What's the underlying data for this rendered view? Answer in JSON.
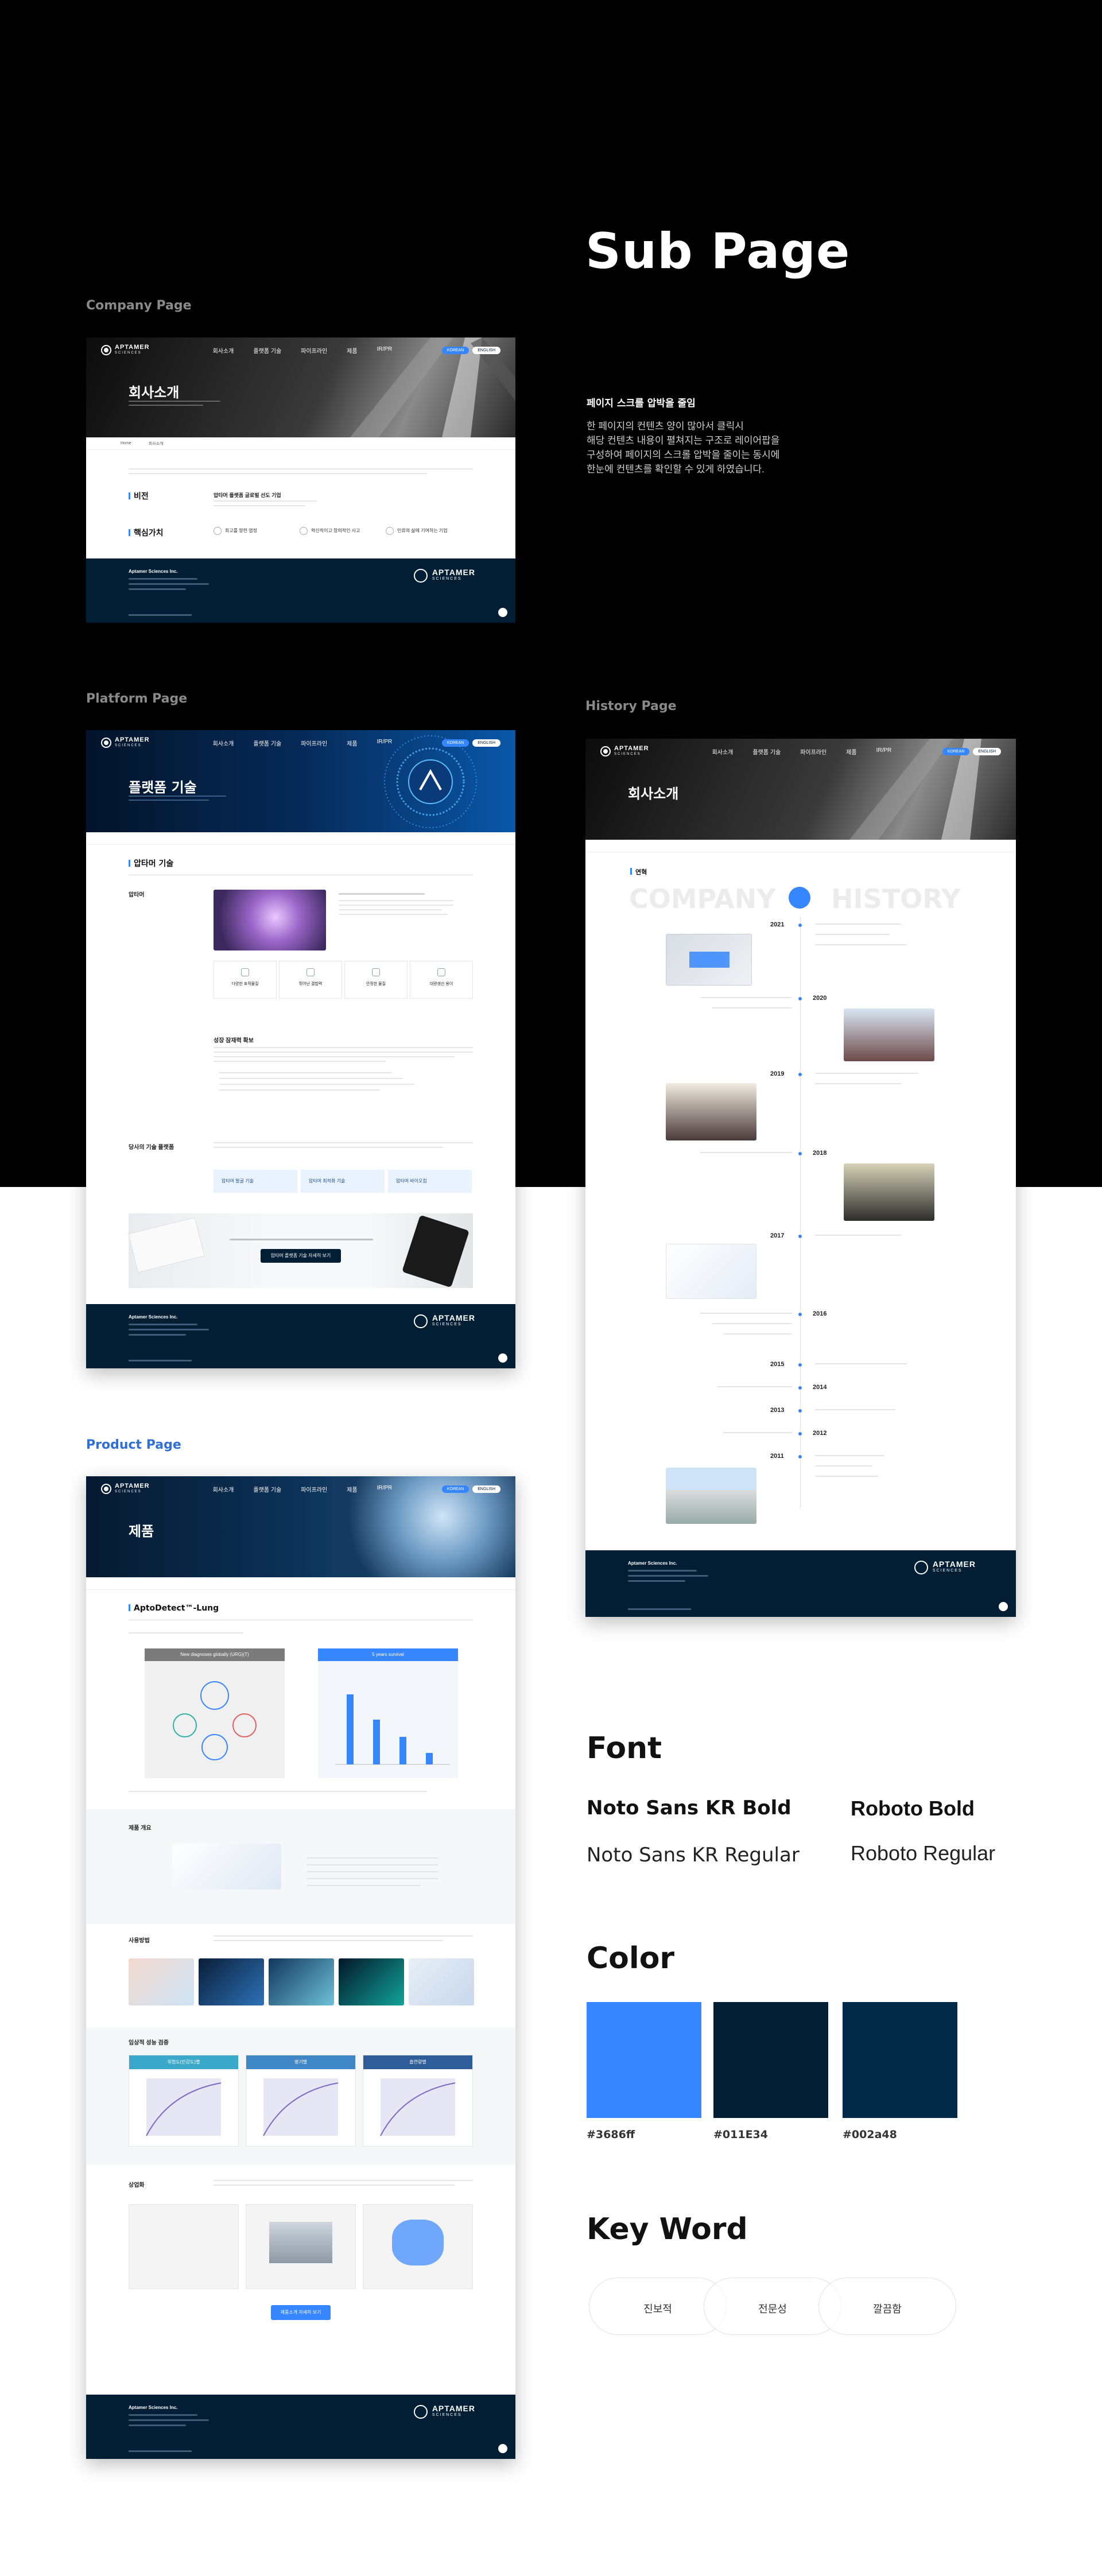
{
  "title": "Sub Page",
  "intro": {
    "heading": "페이지 스크롤 압박을 줄임",
    "lines": [
      "한 페이지의 컨텐츠 양이 많아서 클릭시",
      "해당 컨텐츠 내용이 펼쳐지는 구조로 레이어팝을",
      "구성하여 페이지의 스크롤 압박을 줄이는 동시에",
      "한눈에 컨텐츠를 확인할 수 있게 하였습니다."
    ]
  },
  "sections": {
    "company": "Company Page",
    "platform": "Platform Page",
    "history": "History Page",
    "product": "Product Page"
  },
  "brand": {
    "name": "APTAMER",
    "tagline": "SCIENCES",
    "company_name": "Aptamer Sciences Inc."
  },
  "nav": {
    "items": [
      "회사소개",
      "플랫폼 기술",
      "파이프라인",
      "제품",
      "IR/PR"
    ],
    "lang_kr": "KOREAN",
    "lang_en": "ENGLISH"
  },
  "company_page": {
    "hero_title": "회사소개",
    "breadcrumb": [
      "Home",
      "회사소개"
    ],
    "vision_heading": "비전",
    "vision_text": "압타머 플랫폼 글로벌 선도 기업",
    "values_heading": "핵심가치",
    "values": [
      "최고를 향한 열정",
      "혁신적이고 창의적인 사고",
      "인류의 삶에 기여하는 기업"
    ]
  },
  "platform_page": {
    "hero_title": "플랫폼 기술",
    "section_heading": "압타머 기술",
    "item_label": "압타머",
    "features": [
      "다양한 표적물질",
      "뛰어난 결합력",
      "안정한 물질",
      "대량생산 용이"
    ],
    "subheading": "성장 잠재력 확보",
    "partner_heading": "당사의 기술 플랫폼",
    "tech_buttons": [
      "압타머 발굴 기술",
      "압타머 최적화 기술",
      "압타머 바이오칩"
    ],
    "cta_button": "압타머 플랫폼 기술 자세히 보기"
  },
  "history_page": {
    "hero_title": "회사소개",
    "heading": "연혁",
    "big_title_left": "COMPANY",
    "big_title_right": "HISTORY",
    "years": [
      "2021",
      "2020",
      "2019",
      "2018",
      "2017",
      "2016",
      "2015",
      "2014",
      "2013",
      "2012",
      "2011"
    ]
  },
  "product_page": {
    "hero_title": "제품",
    "product_heading": "AptoDetect™-Lung",
    "chart_left_title": "New diagnoses globally (URG)(T)",
    "chart_right_title": "5 years survival",
    "section_overview": "제품 개요",
    "section_method": "사용방법",
    "section_clinical": "임상적 성능 검증",
    "clinical_tabs": [
      "위험도(민감도)별",
      "병기별",
      "흡연량별"
    ],
    "section_commercial": "상업화",
    "more_button": "제품소개 자세히 보기"
  },
  "font": {
    "heading": "Font",
    "items": [
      "Noto Sans KR Bold",
      "Roboto Bold",
      "Noto Sans KR Regular",
      "Roboto Regular"
    ]
  },
  "color": {
    "heading": "Color",
    "swatches": [
      {
        "label": "#3686ff",
        "hex": "#3686ff"
      },
      {
        "label": "#011E34",
        "hex": "#011e34"
      },
      {
        "label": "#002a48",
        "hex": "#002a48"
      }
    ]
  },
  "keyword": {
    "heading": "Key Word",
    "items": [
      "진보적",
      "전문성",
      "깔끔함"
    ]
  }
}
